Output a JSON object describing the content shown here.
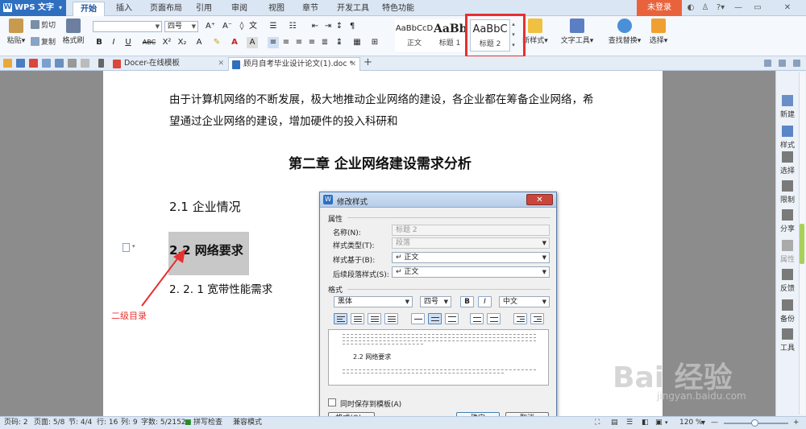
{
  "app": {
    "name": "WPS 文字",
    "menu_tabs": [
      "开始",
      "插入",
      "页面布局",
      "引用",
      "审阅",
      "视图",
      "章节",
      "开发工具",
      "特色功能"
    ],
    "login": "未登录"
  },
  "ribbon": {
    "paste": "粘贴",
    "cut": "剪切",
    "copy": "复制",
    "format_painter": "格式刷",
    "font_name": "",
    "font_size": "四号",
    "bold": "B",
    "italic": "I",
    "underline": "U",
    "strike": "ABC",
    "superscript": "X²",
    "subscript": "X₂",
    "styles": [
      {
        "preview": "AaBbCcD",
        "name": "正文"
      },
      {
        "preview": "AaBb",
        "name": "标题 1"
      },
      {
        "preview": "AaBbC",
        "name": "标题 2"
      }
    ],
    "new_style": "新样式",
    "text_tools": "文字工具",
    "find_replace": "查找替换",
    "select": "选择"
  },
  "doc_tabs": [
    {
      "label": "Docer-在线模板"
    },
    {
      "label": "顾月自考毕业设计论文(1).doc *"
    }
  ],
  "document": {
    "para1_line1": "由于计算机网络的不断发展，极大地推动企业网络的建设，各企业都在筹备企业网络，希",
    "para1_line2": "望通过企业网络的建设，增加硬件的投入科研和",
    "chapter_title": "第二章  企业网络建设需求分析",
    "h21": "2.1 企业情况",
    "h22": "2.2 网络要求",
    "h221": "2. 2. 1 宽带性能需求",
    "annotation": "二级目录"
  },
  "dialog": {
    "title": "修改样式",
    "section_props": "属性",
    "name_label": "名称(N):",
    "name_value": "标题 2",
    "type_label": "样式类型(T):",
    "type_value": "段落",
    "based_label": "样式基于(B):",
    "based_value": "↵ 正文",
    "next_label": "后续段落样式(S):",
    "next_value": "↵ 正文",
    "section_format": "格式",
    "font": "黑体",
    "size": "四号",
    "bold": "B",
    "italic": "I",
    "lang": "中文",
    "preview_heading": "2.2 网络要求",
    "save_template": "同时保存到模板(A)",
    "format_btn": "格式(O) ▾",
    "ok": "确定",
    "cancel": "取消"
  },
  "sidebar": [
    "新建",
    "样式",
    "选择",
    "限制",
    "分享",
    "属性",
    "反馈",
    "备份",
    "工具"
  ],
  "status": {
    "page_code": "页码: 2",
    "page": "页面: 5/8",
    "section": "节: 4/4",
    "row": "行: 16",
    "col": "列: 9",
    "words": "字数: 5/2152",
    "spell": "拼写检查",
    "compat": "兼容模式",
    "zoom": "120 %"
  },
  "watermark": {
    "brand": "Bai 经验",
    "url": "jingyan.baidu.com"
  }
}
